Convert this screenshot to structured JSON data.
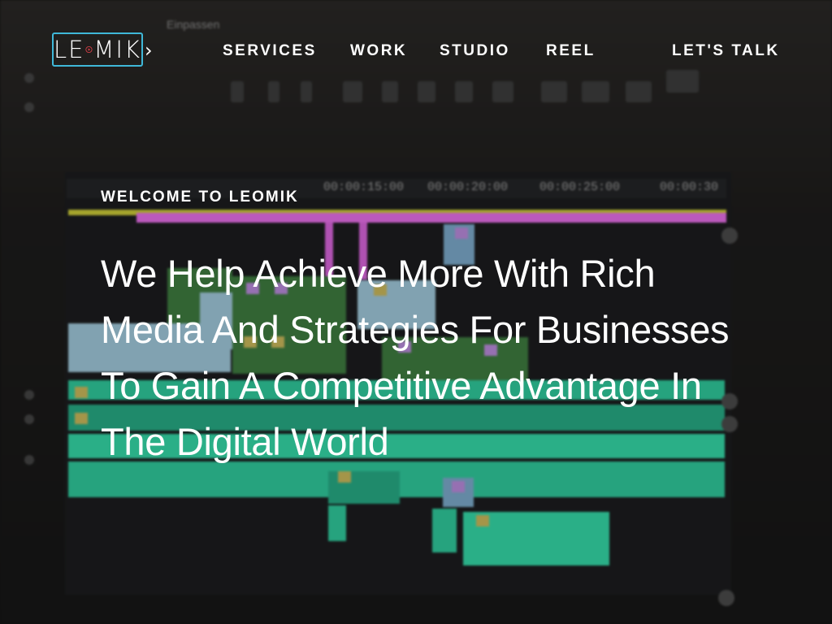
{
  "brand": {
    "logo_text_left": "LE",
    "logo_text_right": "MIK",
    "accent": "#3fb8d8",
    "mark_color": "#e2424b"
  },
  "nav": {
    "services": "SERVICES",
    "work": "WORK",
    "studio": "STUDIO",
    "reel": "REEL",
    "cta": "LET'S TALK"
  },
  "hero": {
    "eyebrow": "WELCOME TO LEOMIK",
    "headline": "We Help Achieve More With Rich Media And Strategies For Businesses To Gain A Competitive Advantage In The Digital World"
  },
  "background_timecodes": [
    "00:00:15:00",
    "00:00:20:00",
    "00:00:25:00",
    "00:00:30"
  ],
  "background_label": "Einpassen"
}
